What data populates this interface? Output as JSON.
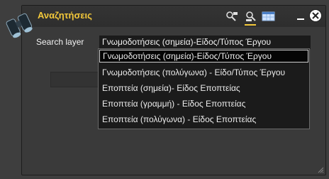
{
  "window": {
    "title": "Αναζητήσεις",
    "title_color": "#f3c83a",
    "icons": [
      "binoculars-icon",
      "search-tool-icon",
      "filter-tool-icon",
      "table-icon",
      "minimize-icon",
      "close-icon"
    ]
  },
  "search": {
    "label": "Search layer",
    "selected_value": "Γνωμοδοτήσεις (σημεία)-Είδος/Τύπος Έργου",
    "options": [
      "Γνωμοδοτήσεις (σημεία)-Είδος/Τύπος Έργου",
      "Γνωμοδοτήσεις (πολύγωνα) - Είδο/Τύπος Έργου",
      "Εποπτεία (σημεία)- Είδος Εποπτείας",
      "Εποπτεία (γραμμή) - Είδος Εποπτείας",
      "Εποπτεία (πολύγωνα) -  Είδος Εποπτείας"
    ]
  }
}
